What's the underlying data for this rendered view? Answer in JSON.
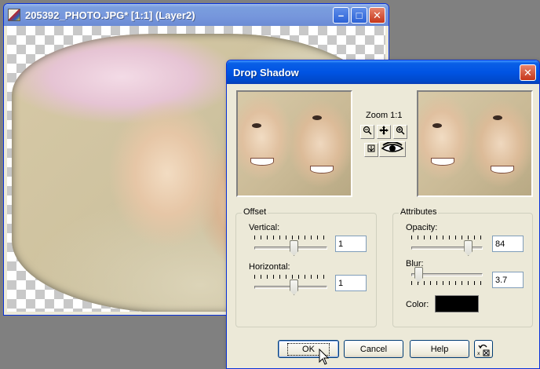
{
  "image_window": {
    "title": "205392_PHOTO.JPG* [1:1] (Layer2)",
    "minimize_glyph": "–",
    "maximize_glyph": "□",
    "close_glyph": "✕"
  },
  "dialog": {
    "title": "Drop Shadow",
    "close_glyph": "✕",
    "zoom_label": "Zoom 1:1",
    "offset": {
      "legend": "Offset",
      "vertical_label": "Vertical:",
      "vertical_value": "1",
      "vertical_level": 0.55,
      "horizontal_label": "Horizontal:",
      "horizontal_value": "1",
      "horizontal_level": 0.55
    },
    "attributes": {
      "legend": "Attributes",
      "opacity_label": "Opacity:",
      "opacity_value": "84",
      "opacity_level": 0.84,
      "blur_label": "Blur:",
      "blur_value": "3.7",
      "blur_level": 0.05,
      "color_label": "Color:",
      "color_value": "#000000"
    },
    "buttons": {
      "ok": "OK",
      "cancel": "Cancel",
      "help": "Help"
    },
    "colors": {
      "title_bar": "#0054e3",
      "face": "#ece9d8"
    }
  }
}
